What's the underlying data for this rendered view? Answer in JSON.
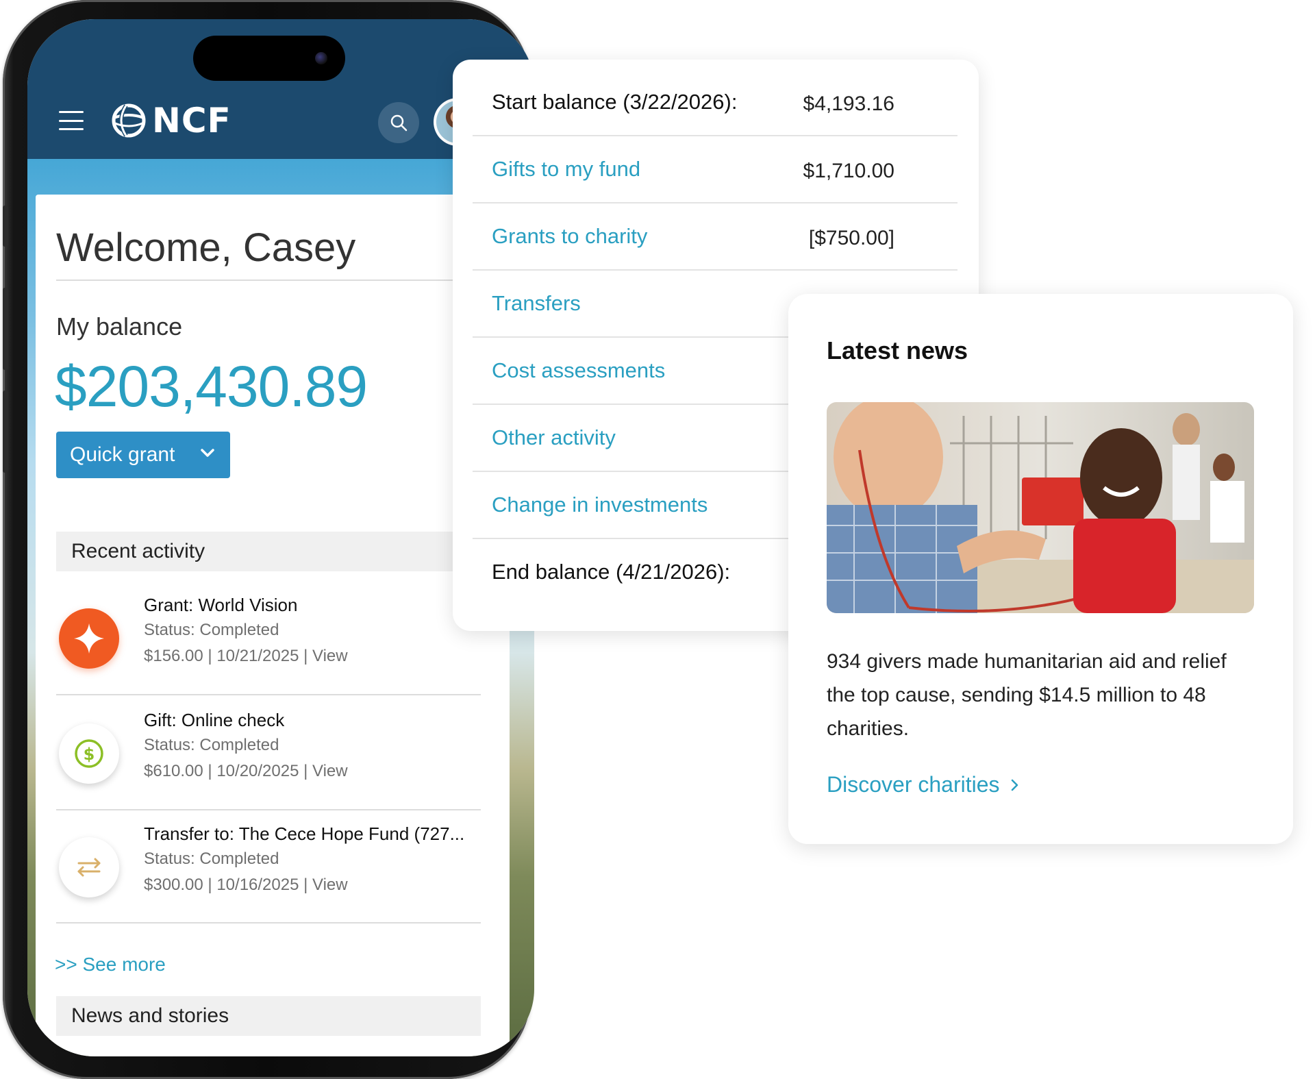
{
  "app": {
    "brand": "NCF",
    "welcome": "Welcome, Casey",
    "balance_label": "My balance",
    "balance_value": "$203,430.89",
    "quick_grant_label": "Quick grant",
    "recent_activity_label": "Recent activity",
    "activities": [
      {
        "title": "Grant: World Vision",
        "status": "Status: Completed",
        "meta": "$156.00 | 10/21/2025 | View",
        "icon": "star-burst-icon"
      },
      {
        "title": "Gift: Online check",
        "status": "Status: Completed",
        "meta": "$610.00 | 10/20/2025 | View",
        "icon": "dollar-coin-icon"
      },
      {
        "title": "Transfer to: The Cece Hope Fund (727...",
        "status": "Status: Completed",
        "meta": "$300.00 | 10/16/2025 | View",
        "icon": "transfer-arrows-icon"
      }
    ],
    "see_more": ">> See more",
    "news_stories_label": "News and stories"
  },
  "balance_summary": {
    "rows": [
      {
        "label": "Start balance (3/22/2026):",
        "value": "$4,193.16"
      },
      {
        "label": "Gifts to my fund",
        "value": "$1,710.00"
      },
      {
        "label": "Grants to charity",
        "value": "[$750.00]"
      },
      {
        "label": "Transfers",
        "value": ""
      },
      {
        "label": "Cost assessments",
        "value": ""
      },
      {
        "label": "Other activity",
        "value": ""
      },
      {
        "label": "Change in investments",
        "value": ""
      },
      {
        "label": "End balance (4/21/2026):",
        "value": ""
      }
    ]
  },
  "news": {
    "title": "Latest news",
    "body": "934 givers made humanitarian aid and relief the top cause, sending $14.5 million to 48 charities.",
    "link": "Discover charities"
  },
  "colors": {
    "header": "#1c4a6e",
    "accent": "#2a9fc1",
    "button": "#2e8fc6",
    "grant_icon": "#f05a22",
    "gift_icon": "#8cbf26",
    "transfer_icon": "#d9b06a"
  }
}
